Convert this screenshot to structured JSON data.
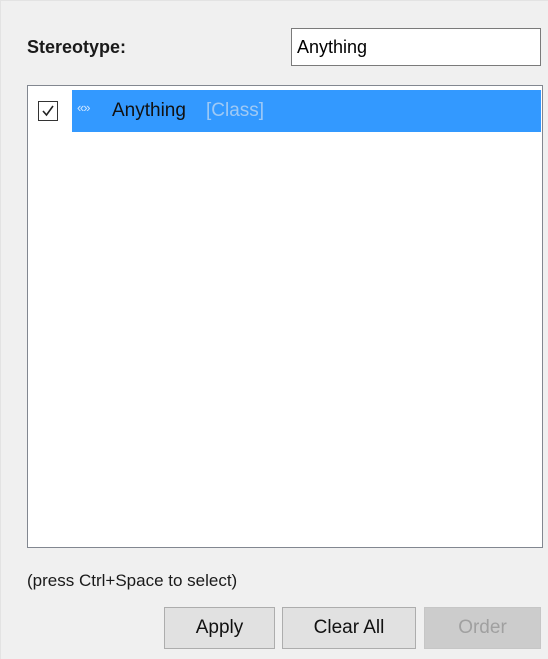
{
  "stereotype": {
    "label": "Stereotype:",
    "input_value": "Anything"
  },
  "list": {
    "items": [
      {
        "checked": true,
        "icon": "stereotype-guillemet-icon",
        "icon_glyph": "«»",
        "name": "Anything",
        "type": "[Class]",
        "selected": true
      }
    ]
  },
  "hint": "(press Ctrl+Space to select)",
  "buttons": {
    "apply": "Apply",
    "clear_all": "Clear All",
    "order": "Order"
  },
  "colors": {
    "selection": "#3399ff",
    "panel_bg": "#f0f0f0",
    "disabled_text": "#a0a0a0"
  }
}
